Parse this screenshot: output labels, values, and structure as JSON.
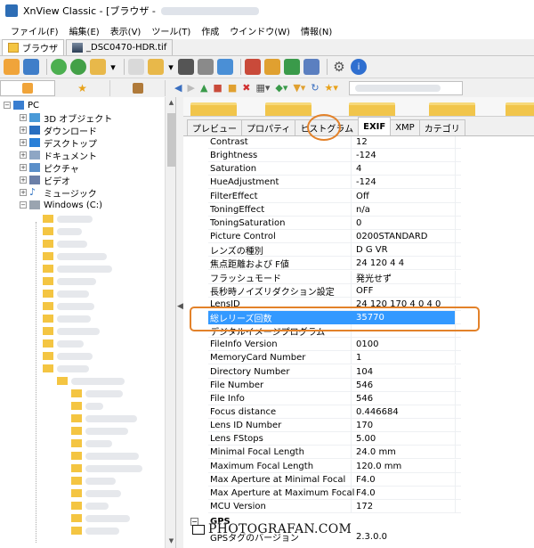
{
  "window": {
    "title": "XnView Classic - [ブラウザ - "
  },
  "menu": [
    "ファイル(F)",
    "編集(E)",
    "表示(V)",
    "ツール(T)",
    "作成",
    "ウインドウ(W)",
    "情報(N)"
  ],
  "doc_tabs": [
    {
      "label": "ブラウザ",
      "icon": "folder-icon",
      "active": true
    },
    {
      "label": "_DSC0470-HDR.tif",
      "icon": "image-icon",
      "active": false
    }
  ],
  "tree": {
    "root": "PC",
    "items": [
      "3D オブジェクト",
      "ダウンロード",
      "デスクトップ",
      "ドキュメント",
      "ピクチャ",
      "ビデオ",
      "ミュージック",
      "Windows (C:)"
    ]
  },
  "info_tabs": [
    "プレビュー",
    "プロパティ",
    "ヒストグラム",
    "EXIF",
    "XMP",
    "カテゴリ"
  ],
  "active_info_tab": "EXIF",
  "exif_rows": [
    {
      "name": "Contrast",
      "value": "12"
    },
    {
      "name": "Brightness",
      "value": "-124"
    },
    {
      "name": "Saturation",
      "value": "4"
    },
    {
      "name": "HueAdjustment",
      "value": "-124"
    },
    {
      "name": "FilterEffect",
      "value": "Off"
    },
    {
      "name": "ToningEffect",
      "value": "n/a"
    },
    {
      "name": "ToningSaturation",
      "value": "0"
    },
    {
      "name": "Picture Control",
      "value": "0200STANDARD"
    },
    {
      "name": "レンズの種別",
      "value": "D G VR"
    },
    {
      "name": "焦点距離および F値",
      "value": "24 120 4 4"
    },
    {
      "name": "フラッシュモード",
      "value": "発光せず"
    },
    {
      "name": "長秒時ノイズリダクション設定",
      "value": "OFF"
    },
    {
      "name": "LensID",
      "value": "24 120 170 4 0 4 0"
    },
    {
      "name": "総レリーズ回数",
      "value": "35770"
    },
    {
      "name": "デジタルイメージプログラム",
      "value": ""
    },
    {
      "name": "FileInfo Version",
      "value": "0100"
    },
    {
      "name": "MemoryCard Number",
      "value": "1"
    },
    {
      "name": "Directory Number",
      "value": "104"
    },
    {
      "name": "File Number",
      "value": "546"
    },
    {
      "name": "File Info",
      "value": "546"
    },
    {
      "name": "Focus distance",
      "value": "0.446684"
    },
    {
      "name": "Lens ID Number",
      "value": "170"
    },
    {
      "name": "Lens FStops",
      "value": "5.00"
    },
    {
      "name": "Minimal Focal Length",
      "value": "24.0 mm"
    },
    {
      "name": "Maximum Focal Length",
      "value": "120.0 mm"
    },
    {
      "name": "Max Aperture at Minimal Focal",
      "value": "F4.0"
    },
    {
      "name": "Max Aperture at Maximum Focal",
      "value": "F4.0"
    },
    {
      "name": "MCU Version",
      "value": "172"
    }
  ],
  "selected_row": "総レリーズ回数",
  "group_gps": {
    "name": "GPS"
  },
  "gps_row": {
    "name": "GPSタグのバージョン",
    "value": "2.3.0.0"
  },
  "watermark": "PHOTOGRAFAN.COM",
  "colors": {
    "highlight": "#e3822a",
    "selection": "#3399ff"
  }
}
